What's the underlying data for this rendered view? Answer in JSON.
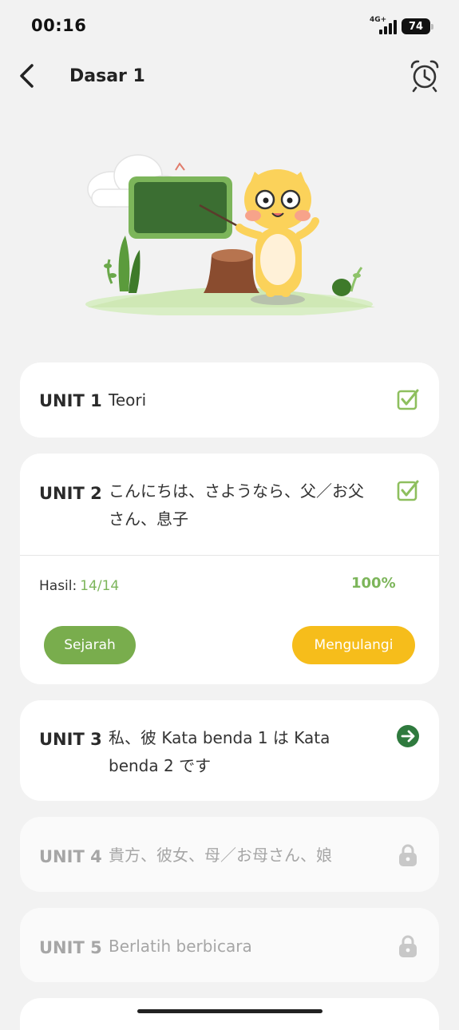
{
  "status_bar": {
    "time": "00:16",
    "network": "4G+",
    "battery": "74"
  },
  "header": {
    "title": "Dasar 1",
    "back_icon": "chevron-left-icon",
    "alarm_icon": "alarm-clock-icon"
  },
  "units": [
    {
      "label": "UNIT 1",
      "title": "Teori",
      "status": "completed",
      "icon": "checkbox-checked-icon"
    },
    {
      "label": "UNIT 2",
      "title_line1": "こんにちは、さようなら、父／お父",
      "title_line2": "さん、息子",
      "status": "completed",
      "icon": "checkbox-checked-icon",
      "result": {
        "label": "Hasil:",
        "score": "14/14",
        "percent": "100%"
      },
      "history_button": "Sejarah",
      "repeat_button": "Mengulangi"
    },
    {
      "label": "UNIT 3",
      "title_line1": "私、彼 Kata benda 1 は Kata",
      "title_line2": "benda 2 です",
      "status": "current",
      "icon": "arrow-right-circle-icon"
    },
    {
      "label": "UNIT 4",
      "title": "貴方、彼女、母／お母さん、娘",
      "status": "locked",
      "icon": "lock-icon"
    },
    {
      "label": "UNIT 5",
      "title": "Berlatih berbicara",
      "status": "locked",
      "icon": "lock-icon"
    }
  ],
  "colors": {
    "accent_green": "#7cb55a",
    "button_green": "#79ad4d",
    "button_yellow": "#f6bd1b",
    "current_green": "#2f7a3e",
    "locked_gray": "#a6a6a6"
  }
}
